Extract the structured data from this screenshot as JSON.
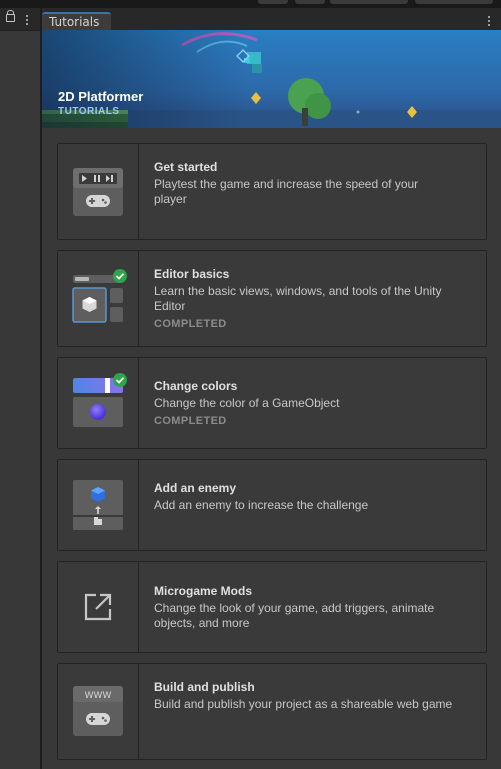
{
  "window": {
    "tab_label": "Tutorials"
  },
  "banner": {
    "title": "2D Platformer",
    "subtitle": "TUTORIALS"
  },
  "tutorials": [
    {
      "title": "Get started",
      "description": "Playtest the game and increase the speed of your player",
      "status": ""
    },
    {
      "title": "Editor basics",
      "description": "Learn the basic views, windows, and tools of the Unity Editor",
      "status": "COMPLETED"
    },
    {
      "title": "Change colors",
      "description": "Change the color of a GameObject",
      "status": "COMPLETED"
    },
    {
      "title": "Add an enemy",
      "description": "Add an enemy to increase the challenge",
      "status": ""
    },
    {
      "title": "Microgame Mods",
      "description": "Change the look of your game, add triggers, animate objects, and more",
      "status": ""
    },
    {
      "title": "Build and publish",
      "description": "Build and publish your project as a shareable web game",
      "status": ""
    }
  ],
  "icons": {
    "get_started": "playmode-gamepad-icon",
    "editor_basics": "editor-layout-icon",
    "change_colors": "color-slider-icon",
    "add_enemy": "add-enemy-icon",
    "mods": "external-link-icon",
    "publish": "www-gamepad-icon"
  },
  "www_label": "WWW",
  "colors": {
    "accent": "#3a72b0",
    "completed_check": "#2ea54a",
    "banner_bg": "#2f5a93"
  }
}
